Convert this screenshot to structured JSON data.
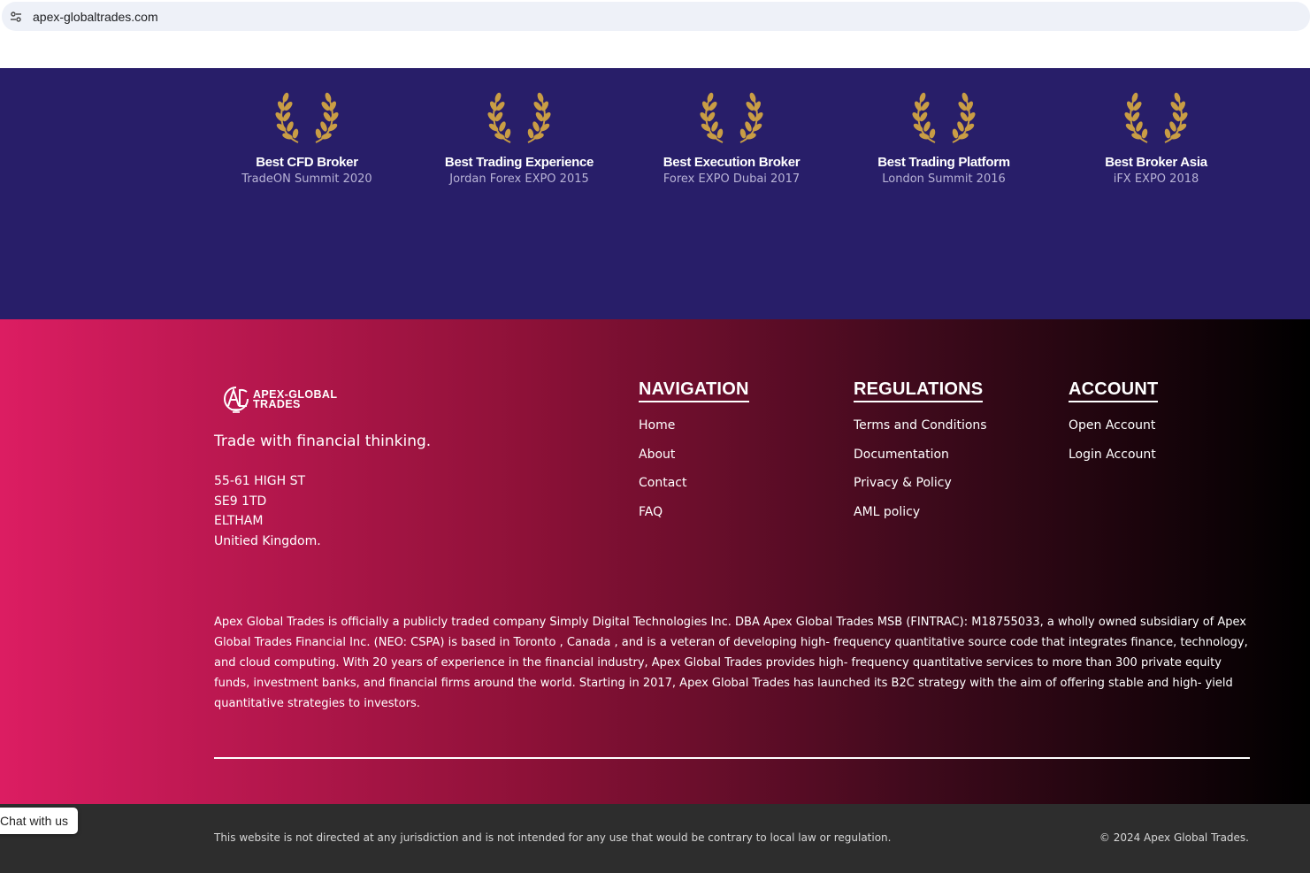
{
  "browser": {
    "url": "apex-globaltrades.com",
    "site_info_icon": "tune-icon"
  },
  "awards": [
    {
      "title": "Best CFD Broker",
      "event": "TradeON Summit 2020"
    },
    {
      "title": "Best Trading Experience",
      "event": "Jordan Forex EXPO 2015"
    },
    {
      "title": "Best Execution Broker",
      "event": "Forex EXPO Dubai 2017"
    },
    {
      "title": "Best Trading Platform",
      "event": "London Summit 2016"
    },
    {
      "title": "Best Broker Asia",
      "event": "iFX EXPO 2018"
    }
  ],
  "footer": {
    "logo": {
      "line1": "APEX-GLOBAL",
      "line2": "TRADES"
    },
    "tagline": "Trade with financial thinking.",
    "address": [
      "55-61 HIGH ST",
      "SE9 1TD",
      "ELTHAM",
      "Unitied Kingdom."
    ],
    "navigation": {
      "heading": "NAVIGATION",
      "items": [
        "Home",
        "About",
        "Contact",
        "FAQ"
      ]
    },
    "regulations": {
      "heading": "REGULATIONS",
      "items": [
        "Terms and Conditions",
        "Documentation",
        "Privacy & Policy",
        "AML policy"
      ]
    },
    "account": {
      "heading": "ACCOUNT",
      "items": [
        "Open Account",
        "Login Account"
      ]
    },
    "disclaimer": "Apex Global Trades is officially a publicly traded company Simply Digital Technologies Inc. DBA Apex Global Trades MSB (FINTRAC): M18755033, a wholly owned subsidiary of Apex Global Trades Financial Inc. (NEO: CSPA) is based in Toronto , Canada , and is a veteran of developing high- frequency quantitative source code that integrates finance, technology, and cloud computing. With 20 years of experience in the financial industry, Apex Global Trades provides high- frequency quantitative services to more than 300 private equity funds, investment banks, and financial firms around the world. Starting in 2017, Apex Global Trades has launched its B2C strategy with the aim of offering stable and high- yield quantitative strategies to investors."
  },
  "bottom": {
    "notice": "This website is not directed at any jurisdiction and is not intended for any use that would be contrary to local law or regulation.",
    "copyright": "© 2024 Apex Global Trades."
  },
  "chat": {
    "label": "Chat with us"
  },
  "colors": {
    "awards_bg": "#281e69",
    "gold": "#c99d45",
    "footer_start": "#dc1d62",
    "footer_end": "#000000",
    "bottom_bg": "#2d2d2d"
  }
}
